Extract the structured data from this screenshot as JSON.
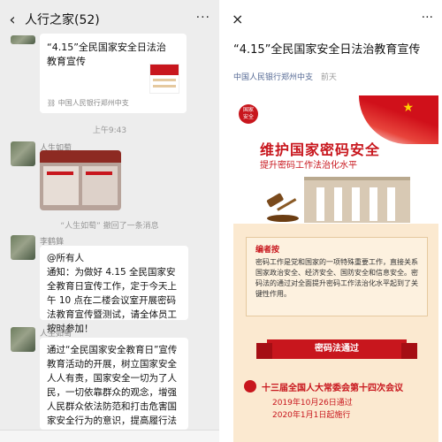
{
  "left": {
    "header": {
      "back": "‹",
      "title": "人行之家(52)",
      "more": "···"
    },
    "card": {
      "title": "“4.15”全民国家安全日法治教育宣传",
      "source": "中国人民银行郑州中支"
    },
    "time": "上午9:43",
    "msg1": {
      "name": "人生如萄"
    },
    "recall": "“人生如萄” 撤回了一条消息",
    "msg2": {
      "name": "李鹤鋒",
      "text": "@所有人\n通知：为做好 4.15 全民国家安全教育日宣传工作，定于今天上午 10 点在二楼会议室开展密码法教育宣传暨测试，请全体员工按时参加！"
    },
    "msg3": {
      "name": "人生如萄",
      "text": "通过“全民国家安全教育日”宣传教育活动的开展，树立国家安全人人有责，国家安全一切为了人民，一切依靠群众的观念，增强人民群众依法防范和打击危害国家安全行为的意识，提高履行法律责任义务的"
    }
  },
  "right": {
    "close": "×",
    "more": "···",
    "title": "“4.15”全民国家安全日法治教育宣传",
    "author": "中国人民银行郑州中支",
    "date": "前天",
    "author_color": "#576b95",
    "poster": {
      "badge": "国家\n安全",
      "slogan1": "维护国家密码安全",
      "slogan2": "提升密码工作法治化水平",
      "editor_tag": "编者按",
      "editor_text": "密码工作是党和国家的一项特殊重要工作，直接关系国家政治安全、经济安全、国防安全和信息安全。密码法的通过对全面提升密码工作法治化水平起到了关键性作用。",
      "ribbon": "密码法通过",
      "event_head": "十三届全国人大常委会第十四次会议",
      "event_line1": "2019年10月26日通过",
      "event_line2": "2020年1月1日起施行"
    }
  }
}
